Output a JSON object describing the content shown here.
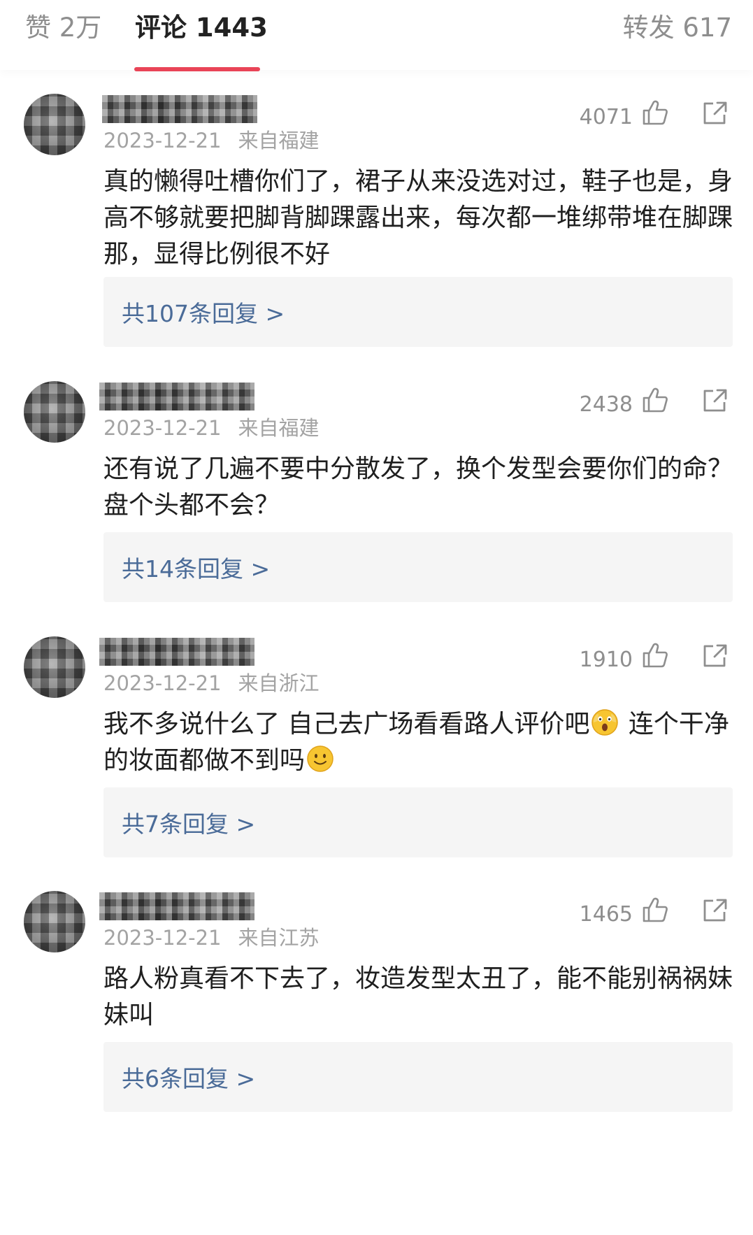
{
  "tabs": {
    "likes": "赞 2万",
    "comments": "评论 1443",
    "shares": "转发 617"
  },
  "colors": {
    "accent": "#e94457",
    "link": "#4a6b98",
    "muted": "#a3a3a3"
  },
  "comments": [
    {
      "username": "",
      "date": "2023-12-21",
      "location": "来自福建",
      "likes": "4071",
      "text": "真的懒得吐槽你们了，裙子从来没选对过，鞋子也是，身高不够就要把脚背脚踝露出来，每次都一堆绑带堆在脚踝那，显得比例很不好",
      "replies": "共107条回复 >"
    },
    {
      "username": "",
      "date": "2023-12-21",
      "location": "来自福建",
      "likes": "2438",
      "text": "还有说了几遍不要中分散发了，换个发型会要你们的命？盘个头都不会？",
      "replies": "共14条回复 >"
    },
    {
      "username": "",
      "date": "2023-12-21",
      "location": "来自浙江",
      "likes": "1910",
      "text_a": "我不多说什么了 自己去广场看看路人评价吧",
      "emoji_a": "scream-emoji",
      "text_b": " 连个干净的妆面都做不到吗",
      "emoji_b": "smile-emoji",
      "replies": "共7条回复 >"
    },
    {
      "username": "",
      "date": "2023-12-21",
      "location": "来自江苏",
      "likes": "1465",
      "text": "路人粉真看不下去了，妆造发型太丑了，能不能别祸祸妹妹叫",
      "replies": "共6条回复 >"
    }
  ]
}
